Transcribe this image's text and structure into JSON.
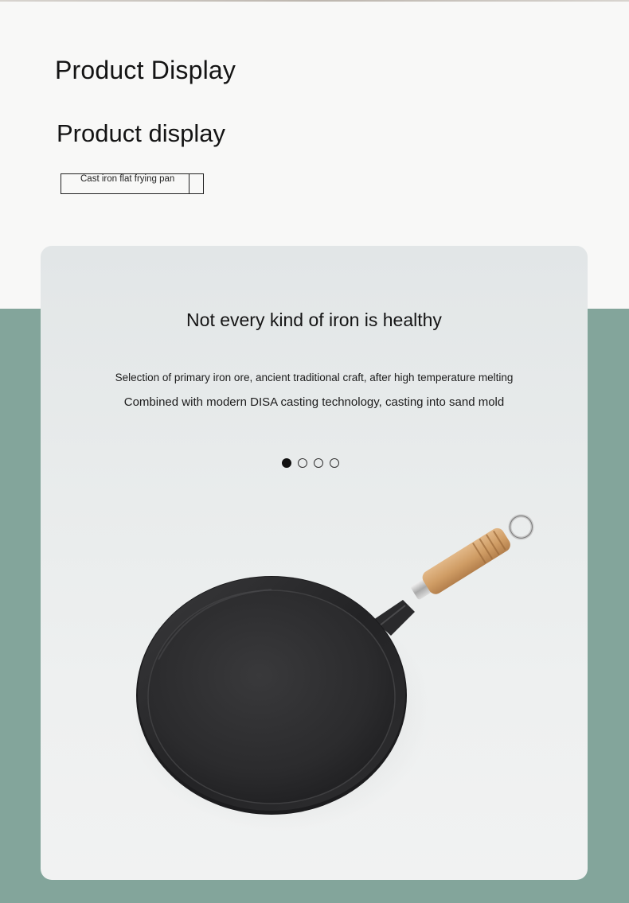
{
  "header": {
    "title": "Product Display",
    "subtitle": "Product display",
    "tag_label": "Cast iron flat frying pan"
  },
  "card": {
    "headline": "Not every kind of iron is healthy",
    "line_1": "Selection of primary iron ore, ancient traditional craft, after high temperature melting",
    "line_2": "Combined with modern DISA casting technology, casting into sand mold",
    "carousel": {
      "total_slides": 4,
      "active_slide": 1
    }
  },
  "colors": {
    "page_background": "#f8f8f7",
    "green_band": "#83a59b",
    "card_background": "#e9ecec",
    "pan_iron": "#2b2b2c",
    "handle_wood": "#d1a06a"
  },
  "images": {
    "product": "cast-iron-flat-frying-pan-with-wooden-handle"
  }
}
